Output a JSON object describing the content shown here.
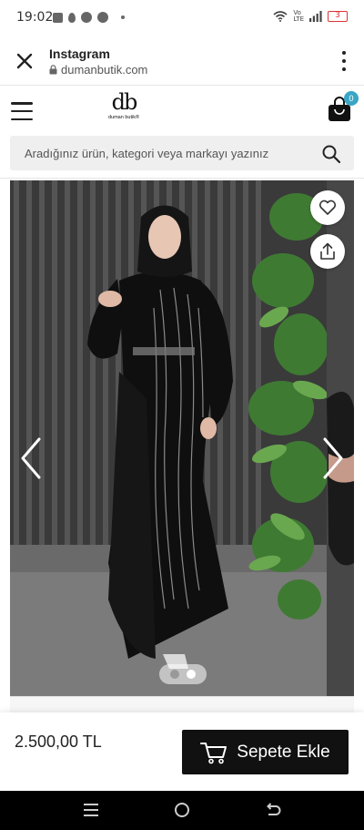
{
  "status_bar": {
    "time": "19:02",
    "network": "Vo\nLTE",
    "battery": "3"
  },
  "browser": {
    "title": "Instagram",
    "url": "dumanbutik.com"
  },
  "site": {
    "logo_mark": "db",
    "logo_text": "duman butik®",
    "cart_count": "0"
  },
  "search": {
    "placeholder": "Aradığınız ürün, kategori veya markayı yazınız",
    "value": ""
  },
  "product": {
    "price": "2.500,00 TL",
    "add_to_cart_label": "Sepete Ekle",
    "gallery_dots": 2,
    "active_dot": 0
  },
  "colors": {
    "badge": "#3aa6c4",
    "button": "#111111",
    "battery": "#dd3333"
  }
}
